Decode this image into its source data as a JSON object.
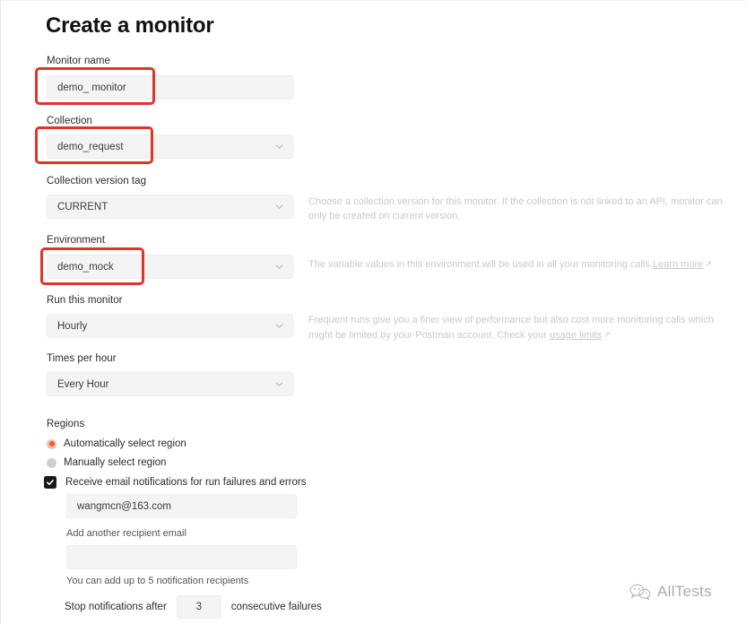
{
  "page": {
    "title": "Create a monitor"
  },
  "fields": {
    "monitor_name": {
      "label": "Monitor name",
      "value": "demo_ monitor",
      "placeholder": "Monitor name"
    },
    "collection": {
      "label": "Collection",
      "value": "demo_request",
      "icon": "chevron-down-icon"
    },
    "collection_version_tag": {
      "label": "Collection version tag",
      "value": "CURRENT",
      "icon": "chevron-down-icon",
      "help": "Choose a collection version for this monitor. If the collection is not linked to an API, monitor can only be created on current version."
    },
    "environment": {
      "label": "Environment",
      "value": "demo_mock",
      "icon": "chevron-down-icon",
      "help": "The variable values in this environment will be used in all your monitoring calls.",
      "help_link": "Learn more"
    },
    "run_this_monitor": {
      "label": "Run this monitor",
      "value": "Hourly",
      "icon": "chevron-down-icon",
      "help": "Frequent runs give you a finer view of performance but also cost more monitoring calls which might be limited by your Postman account. Check your ",
      "help_link": "usage limits"
    },
    "times_per_hour": {
      "label": "Times per hour",
      "value": "Every Hour",
      "icon": "chevron-down-icon"
    }
  },
  "regions": {
    "label": "Regions",
    "options": [
      {
        "label": "Automatically select region",
        "selected": true
      },
      {
        "label": "Manually select region",
        "selected": false
      }
    ]
  },
  "notifications": {
    "checkbox_label": "Receive email notifications for run failures and errors",
    "checkbox_checked": true,
    "recipient_email": "wangmcn@163.com",
    "add_another_label": "Add another recipient email",
    "add_another_value": "",
    "add_another_placeholder": "",
    "limit_hint": "You can add up to 5 notification recipients",
    "stop_prefix": "Stop notifications after",
    "stop_count": "3",
    "stop_suffix": "consecutive failures"
  },
  "watermark": {
    "text": "AllTests",
    "icon": "wechat-logo-icon"
  },
  "annotations": {
    "boxes": [
      {
        "name": "monitor-name-highlight"
      },
      {
        "name": "collection-highlight"
      },
      {
        "name": "environment-highlight"
      }
    ],
    "color": "#e0342b"
  },
  "colors": {
    "accent_orange": "#e1642c",
    "annotation_red": "#e0342b",
    "field_bg": "#f4f4f4",
    "checkbox_dark": "#1a1a1a"
  }
}
